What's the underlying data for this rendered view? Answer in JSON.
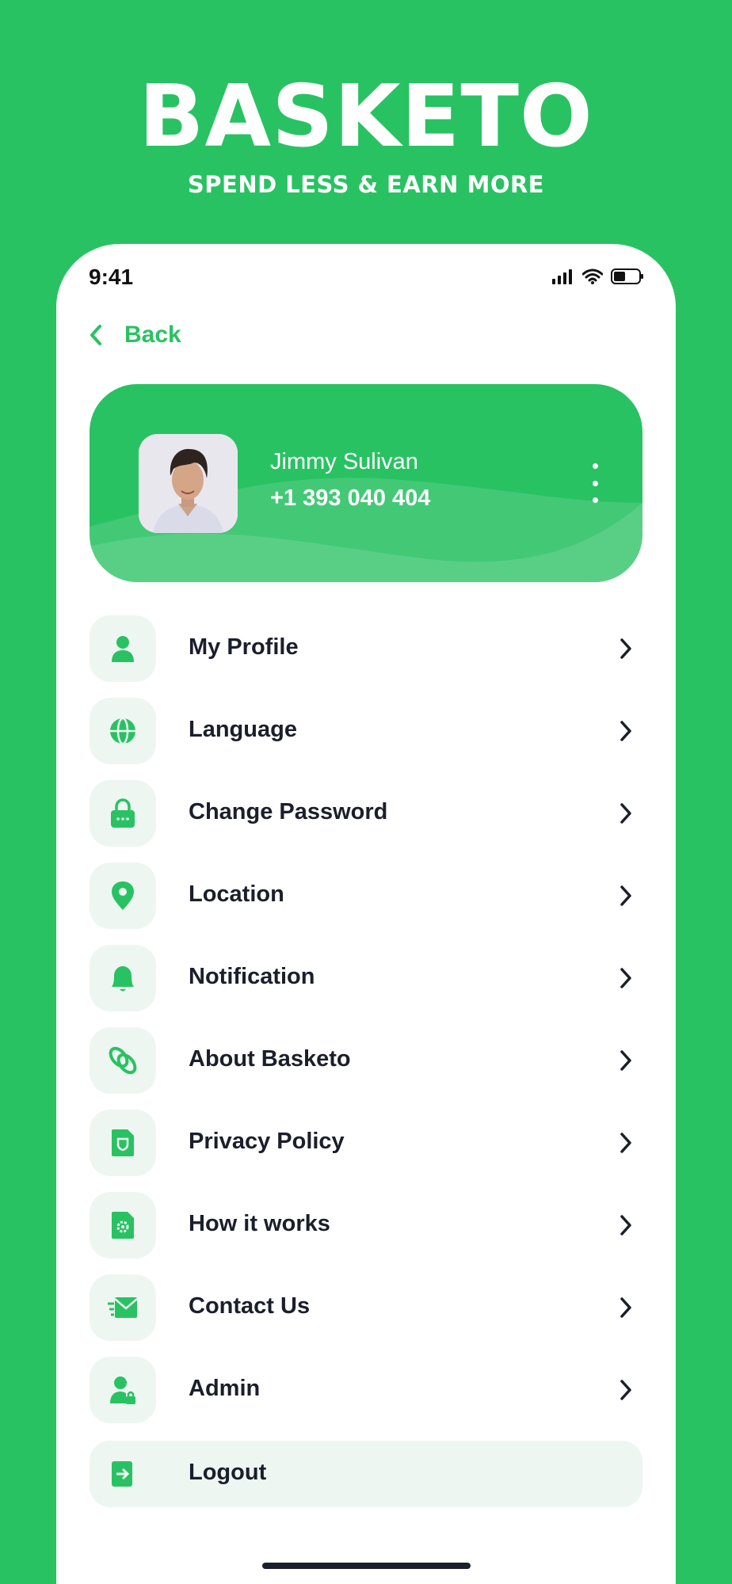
{
  "brand": {
    "title": "BASKETO",
    "subtitle": "SPEND LESS & EARN MORE"
  },
  "status_bar": {
    "time": "9:41",
    "icons": [
      "signal-icon",
      "wifi-icon",
      "battery-icon"
    ]
  },
  "nav": {
    "back_label": "Back"
  },
  "profile": {
    "name": "Jimmy Sulivan",
    "phone": "+1 393 040 404"
  },
  "menu": {
    "items": [
      {
        "label": "My Profile",
        "icon": "user-icon"
      },
      {
        "label": "Language",
        "icon": "globe-icon"
      },
      {
        "label": "Change Password",
        "icon": "lock-icon"
      },
      {
        "label": "Location",
        "icon": "location-pin-icon"
      },
      {
        "label": "Notification",
        "icon": "bell-icon"
      },
      {
        "label": "About Basketo",
        "icon": "link-icon"
      },
      {
        "label": "Privacy Policy",
        "icon": "shield-document-icon"
      },
      {
        "label": "How it works",
        "icon": "gear-document-icon"
      },
      {
        "label": "Contact Us",
        "icon": "mail-icon"
      },
      {
        "label": "Admin",
        "icon": "admin-user-lock-icon"
      }
    ],
    "logout_label": "Logout"
  },
  "colors": {
    "accent": "#29c263",
    "icon_bg": "#eef6f1",
    "text_dark": "#1b1e2b",
    "white": "#ffffff"
  }
}
